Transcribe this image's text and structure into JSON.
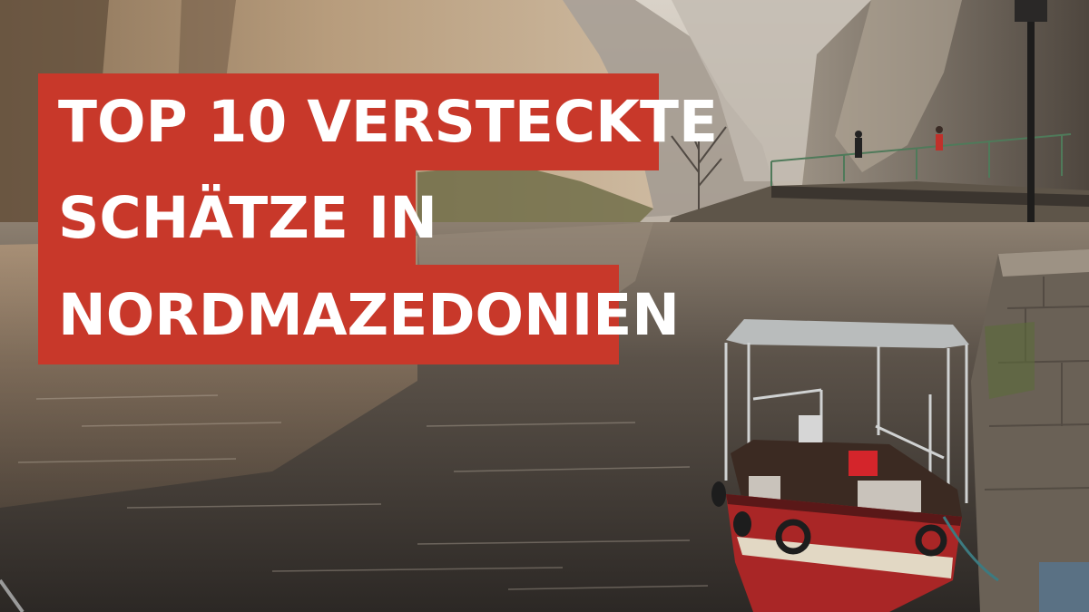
{
  "headline": {
    "line1": "TOP 10 VERSTECKTE",
    "line2": "SCHÄTZE IN",
    "line3": "NORDMAZEDONIEN"
  },
  "colors": {
    "banner": "#c8382a",
    "text": "#ffffff"
  }
}
